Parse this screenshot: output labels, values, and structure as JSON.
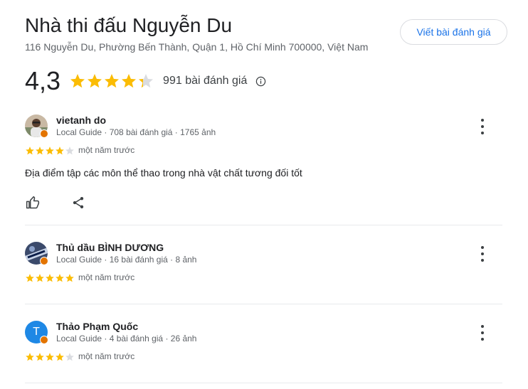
{
  "place": {
    "title": "Nhà thi đấu Nguyễn Du",
    "address": "116 Nguyễn Du, Phường Bến Thành, Quận 1, Hồ Chí Minh 700000, Việt Nam",
    "write_review_label": "Viết bài đánh giá",
    "rating": "4,3",
    "rating_value": 4.3,
    "review_count_label": "991 bài đánh giá"
  },
  "colors": {
    "star": "#fbbc04",
    "star_empty": "#dadce0",
    "link": "#1a73e8"
  },
  "reviews": [
    {
      "name": "vietanh do",
      "meta": "Local Guide · 708 bài đánh giá · 1765 ảnh",
      "stars": 4,
      "time": "một năm trước",
      "text": "Địa điểm tập các môn thể thao trong nhà vật chất tương đối tốt",
      "avatar_icon": "user-photo-icon"
    },
    {
      "name": "Thủ dầu BÌNH DƯƠNG",
      "meta": "Local Guide · 16 bài đánh giá · 8 ảnh",
      "stars": 5,
      "time": "một năm trước",
      "avatar_icon": "user-photo-icon"
    },
    {
      "name": "Thảo Phạm Quốc",
      "meta": "Local Guide · 4 bài đánh giá · 26 ảnh",
      "stars": 4,
      "time": "một năm trước",
      "avatar_letter": "T"
    }
  ]
}
